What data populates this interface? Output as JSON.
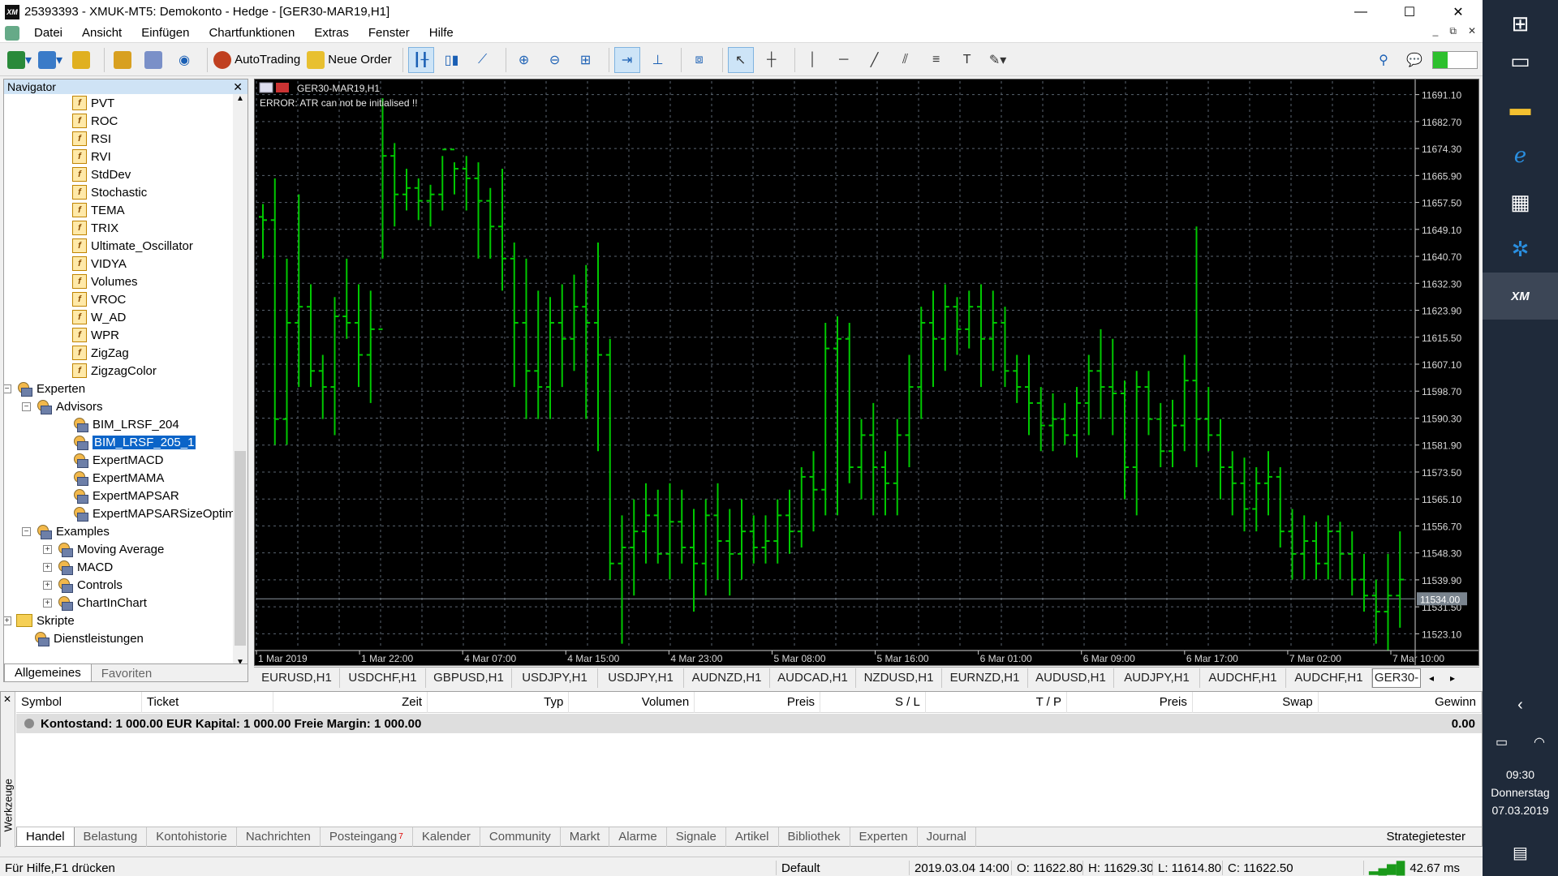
{
  "window": {
    "title": "25393393 - XMUK-MT5: Demokonto - Hedge - [GER30-MAR19,H1]",
    "app_icon": "XM",
    "min": "—",
    "max": "☐",
    "close": "✕"
  },
  "menu": [
    "Datei",
    "Ansicht",
    "Einfügen",
    "Chartfunktionen",
    "Extras",
    "Fenster",
    "Hilfe"
  ],
  "toolbar": {
    "autotrading": "AutoTrading",
    "neue_order": "Neue Order"
  },
  "navigator": {
    "title": "Navigator",
    "indicators": [
      "PVT",
      "ROC",
      "RSI",
      "RVI",
      "StdDev",
      "Stochastic",
      "TEMA",
      "TRIX",
      "Ultimate_Oscillator",
      "VIDYA",
      "Volumes",
      "VROC",
      "W_AD",
      "WPR",
      "ZigZag",
      "ZigzagColor"
    ],
    "experten": "Experten",
    "advisors": "Advisors",
    "advisor_items": [
      "BIM_LRSF_204",
      "BIM_LRSF_205_1",
      "ExpertMACD",
      "ExpertMAMA",
      "ExpertMAPSAR",
      "ExpertMAPSARSizeOptim"
    ],
    "examples": "Examples",
    "example_items": [
      "Moving Average",
      "MACD",
      "Controls",
      "ChartInChart"
    ],
    "skripte": "Skripte",
    "dienstleistungen": "Dienstleistungen",
    "tabs": [
      "Allgemeines",
      "Favoriten"
    ]
  },
  "chart": {
    "symbol_label": "GER30-MAR19,H1",
    "error": "ERROR: ATR can not be initialised !!",
    "current_price": "11534.00",
    "price_labels": [
      "11691.10",
      "11682.70",
      "11674.30",
      "11665.90",
      "11657.50",
      "11649.10",
      "11640.70",
      "11632.30",
      "11623.90",
      "11615.50",
      "11607.10",
      "11598.70",
      "11590.30",
      "11581.90",
      "11573.50",
      "11565.10",
      "11556.70",
      "11548.30",
      "11539.90",
      "11531.50",
      "11523.10"
    ],
    "time_labels": [
      "1 Mar 2019",
      "1 Mar 22:00",
      "4 Mar 07:00",
      "4 Mar 15:00",
      "4 Mar 23:00",
      "5 Mar 08:00",
      "5 Mar 16:00",
      "6 Mar 01:00",
      "6 Mar 09:00",
      "6 Mar 17:00",
      "7 Mar 02:00",
      "7 Mar 10:00"
    ],
    "bar_color": "#00c800",
    "grid_color": "#5a6470"
  },
  "chart_data": {
    "type": "bar",
    "title": "GER30-MAR19,H1",
    "xlabel": "",
    "ylabel": "",
    "ylim": [
      11518.9,
      11695.3
    ],
    "grid": true,
    "x": [
      "1 Mar 2019",
      "",
      "",
      "",
      "",
      "",
      "",
      "1 Mar 22:00",
      "",
      "",
      "",
      "",
      "",
      "",
      "",
      "4 Mar 07:00",
      "",
      "",
      "",
      "",
      "",
      "",
      "4 Mar 15:00",
      "",
      "",
      "",
      "",
      "",
      "",
      "",
      "4 Mar 23:00",
      "",
      "",
      "",
      "",
      "",
      "",
      "",
      "5 Mar 08:00",
      "",
      "",
      "",
      "",
      "",
      "",
      "",
      "5 Mar 16:00",
      "",
      "",
      "",
      "",
      "",
      "",
      "",
      "6 Mar 01:00",
      "",
      "",
      "",
      "",
      "",
      "",
      "",
      "6 Mar 09:00",
      "",
      "",
      "",
      "",
      "",
      "",
      "",
      "6 Mar 17:00",
      "",
      "",
      "",
      "",
      "",
      "",
      "",
      "7 Mar 02:00",
      "",
      "",
      "",
      "",
      "",
      "",
      "7 Mar 10:00"
    ],
    "ohlc": [
      [
        11653,
        11657,
        11640,
        11652
      ],
      [
        11652,
        11665,
        11582,
        11590
      ],
      [
        11590,
        11640,
        11582,
        11620
      ],
      [
        11620,
        11660,
        11600,
        11625
      ],
      [
        11625,
        11632,
        11600,
        11605
      ],
      [
        11605,
        11610,
        11590,
        11600
      ],
      [
        11600,
        11628,
        11585,
        11622
      ],
      [
        11622,
        11640,
        11615,
        11620
      ],
      [
        11620,
        11632,
        11600,
        11610
      ],
      [
        11610,
        11630,
        11595,
        11618
      ],
      [
        11618,
        11690,
        11640,
        11672
      ],
      [
        11672,
        11676,
        11650,
        11660
      ],
      [
        11660,
        11668,
        11655,
        11662
      ],
      [
        11662,
        11665,
        11652,
        11658
      ],
      [
        11658,
        11663,
        11650,
        11660
      ],
      [
        11660,
        11672,
        11655,
        11674
      ],
      [
        11674,
        11670,
        11660,
        11668
      ],
      [
        11668,
        11672,
        11655,
        11665
      ],
      [
        11665,
        11670,
        11640,
        11658
      ],
      [
        11658,
        11662,
        11640,
        11650
      ],
      [
        11650,
        11668,
        11630,
        11640
      ],
      [
        11640,
        11645,
        11600,
        11620
      ],
      [
        11620,
        11640,
        11590,
        11605
      ],
      [
        11605,
        11630,
        11590,
        11600
      ],
      [
        11600,
        11628,
        11590,
        11620
      ],
      [
        11620,
        11632,
        11600,
        11615
      ],
      [
        11615,
        11635,
        11605,
        11625
      ],
      [
        11625,
        11638,
        11590,
        11620
      ],
      [
        11620,
        11645,
        11580,
        11610
      ],
      [
        11610,
        11615,
        11540,
        11545
      ],
      [
        11545,
        11560,
        11520,
        11550
      ],
      [
        11550,
        11565,
        11535,
        11555
      ],
      [
        11555,
        11570,
        11545,
        11560
      ],
      [
        11560,
        11568,
        11545,
        11548
      ],
      [
        11548,
        11570,
        11540,
        11558
      ],
      [
        11558,
        11568,
        11545,
        11550
      ],
      [
        11550,
        11562,
        11530,
        11545
      ],
      [
        11545,
        11565,
        11535,
        11560
      ],
      [
        11560,
        11570,
        11540,
        11552
      ],
      [
        11552,
        11562,
        11535,
        11548
      ],
      [
        11548,
        11565,
        11540,
        11555
      ],
      [
        11555,
        11560,
        11545,
        11550
      ],
      [
        11550,
        11560,
        11545,
        11552
      ],
      [
        11552,
        11565,
        11545,
        11560
      ],
      [
        11560,
        11568,
        11548,
        11555
      ],
      [
        11555,
        11575,
        11550,
        11572
      ],
      [
        11572,
        11580,
        11555,
        11568
      ],
      [
        11568,
        11620,
        11560,
        11612
      ],
      [
        11612,
        11622,
        11560,
        11615
      ],
      [
        11615,
        11620,
        11570,
        11575
      ],
      [
        11575,
        11590,
        11565,
        11585
      ],
      [
        11585,
        11595,
        11560,
        11575
      ],
      [
        11575,
        11580,
        11560,
        11570
      ],
      [
        11570,
        11590,
        11560,
        11585
      ],
      [
        11585,
        11610,
        11575,
        11600
      ],
      [
        11600,
        11625,
        11590,
        11620
      ],
      [
        11620,
        11630,
        11600,
        11615
      ],
      [
        11615,
        11632,
        11605,
        11625
      ],
      [
        11625,
        11628,
        11610,
        11618
      ],
      [
        11618,
        11630,
        11612,
        11625
      ],
      [
        11625,
        11632,
        11600,
        11615
      ],
      [
        11615,
        11630,
        11605,
        11620
      ],
      [
        11620,
        11625,
        11600,
        11605
      ],
      [
        11605,
        11610,
        11595,
        11600
      ],
      [
        11600,
        11610,
        11585,
        11595
      ],
      [
        11595,
        11600,
        11580,
        11588
      ],
      [
        11588,
        11598,
        11580,
        11590
      ],
      [
        11590,
        11595,
        11582,
        11585
      ],
      [
        11585,
        11600,
        11578,
        11595
      ],
      [
        11595,
        11610,
        11585,
        11605
      ],
      [
        11605,
        11618,
        11590,
        11600
      ],
      [
        11600,
        11615,
        11585,
        11598
      ],
      [
        11598,
        11602,
        11565,
        11575
      ],
      [
        11575,
        11605,
        11560,
        11600
      ],
      [
        11600,
        11605,
        11585,
        11590
      ],
      [
        11590,
        11595,
        11575,
        11580
      ],
      [
        11580,
        11596,
        11575,
        11588
      ],
      [
        11588,
        11610,
        11580,
        11602
      ],
      [
        11602,
        11650,
        11575,
        11590
      ],
      [
        11590,
        11600,
        11580,
        11585
      ],
      [
        11585,
        11590,
        11565,
        11575
      ],
      [
        11575,
        11580,
        11560,
        11570
      ],
      [
        11570,
        11578,
        11555,
        11562
      ],
      [
        11562,
        11575,
        11555,
        11570
      ],
      [
        11570,
        11580,
        11560,
        11572
      ],
      [
        11572,
        11575,
        11550,
        11555
      ],
      [
        11555,
        11562,
        11540,
        11548
      ],
      [
        11548,
        11560,
        11540,
        11552
      ],
      [
        11552,
        11558,
        11540,
        11545
      ],
      [
        11545,
        11560,
        11540,
        11555
      ],
      [
        11555,
        11558,
        11540,
        11548
      ],
      [
        11548,
        11555,
        11535,
        11540
      ],
      [
        11540,
        11548,
        11530,
        11535
      ],
      [
        11535,
        11540,
        11520,
        11530
      ],
      [
        11530,
        11548,
        11518,
        11535
      ],
      [
        11535,
        11555,
        11525,
        11540
      ]
    ]
  },
  "symbol_tabs": [
    "EURUSD,H1",
    "USDCHF,H1",
    "GBPUSD,H1",
    "USDJPY,H1",
    "USDJPY,H1",
    "AUDNZD,H1",
    "AUDCAD,H1",
    "NZDUSD,H1",
    "EURNZD,H1",
    "AUDUSD,H1",
    "AUDJPY,H1",
    "AUDCHF,H1",
    "AUDCHF,H1",
    "GER30-"
  ],
  "terminal": {
    "headers": [
      "Symbol",
      "Ticket",
      "Zeit",
      "Typ",
      "Volumen",
      "Preis",
      "S / L",
      "T / P",
      "Preis",
      "Swap",
      "Gewinn"
    ],
    "balance": "Kontostand: 1 000.00 EUR  Kapital: 1 000.00  Freie Margin: 1 000.00",
    "balance_value": "0.00",
    "side_label": "Werkzeuge",
    "tabs": [
      "Handel",
      "Belastung",
      "Kontohistorie",
      "Nachrichten",
      "Posteingang",
      "Kalender",
      "Community",
      "Markt",
      "Alarme",
      "Signale",
      "Artikel",
      "Bibliothek",
      "Experten",
      "Journal"
    ],
    "posteingang_badge": "7",
    "strategietester": "Strategietester"
  },
  "status": {
    "help": "Für Hilfe,F1 drücken",
    "profile": "Default",
    "time": "2019.03.04 14:00",
    "open": "O: 11622.80",
    "high": "H: 11629.30",
    "low": "L: 11614.80",
    "close": "C: 11622.50",
    "ping": "42.67 ms"
  },
  "taskbar": {
    "time": "09:30",
    "day": "Donnerstag",
    "date": "07.03.2019",
    "xm": "XM"
  }
}
